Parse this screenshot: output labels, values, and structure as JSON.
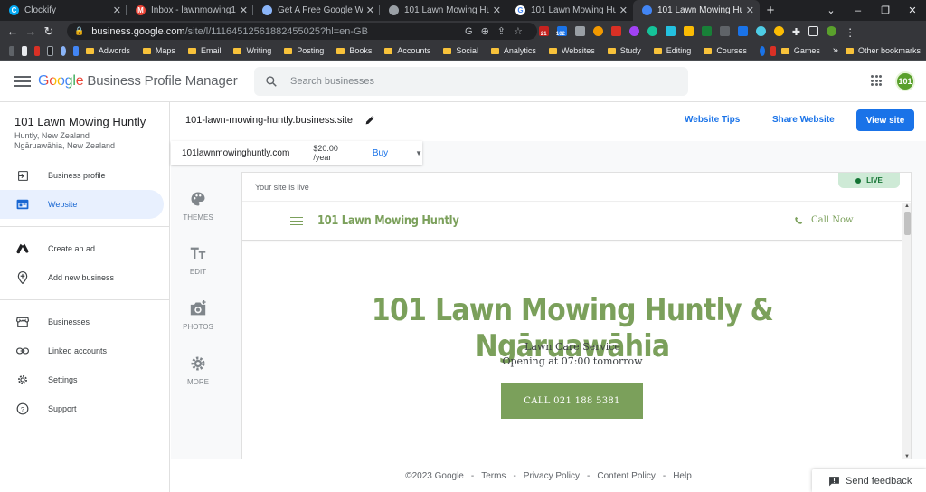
{
  "browser": {
    "tabs": [
      {
        "title": "Clockify",
        "active": false
      },
      {
        "title": "Inbox - lawnmowing101nz",
        "active": false
      },
      {
        "title": "Get A Free Google Website",
        "active": false
      },
      {
        "title": "101 Lawn Mowing Huntly -",
        "active": false
      },
      {
        "title": "101 Lawn Mowing Huntly -",
        "active": false
      },
      {
        "title": "101 Lawn Mowing Huntly",
        "active": true
      }
    ],
    "url_host": "business.google.com",
    "url_path": "/site/l/11164512561882455025?hl=en-GB",
    "bookmarks": [
      "Adwords",
      "Maps",
      "Email",
      "Writing",
      "Posting",
      "Books",
      "Accounts",
      "Social",
      "Analytics",
      "Websites",
      "Study",
      "Editing",
      "Courses",
      "Games"
    ],
    "overflow": "»",
    "other_bookmarks": "Other bookmarks",
    "badges": {
      "calendar": "21",
      "count": "102"
    }
  },
  "header": {
    "logo": "Google",
    "product": "Business Profile Manager",
    "search_placeholder": "Search businesses",
    "avatar_text": "101"
  },
  "sidebar": {
    "business_name": "101 Lawn Mowing Huntly",
    "address_line1": "Huntly, New Zealand",
    "address_line2": "Ngāruawāhia, New Zealand",
    "items": [
      {
        "label": "Business profile",
        "icon": "business-profile-icon"
      },
      {
        "label": "Website",
        "icon": "website-icon",
        "active": true
      },
      {
        "label": "Create an ad",
        "icon": "ads-icon"
      },
      {
        "label": "Add new business",
        "icon": "add-location-icon"
      },
      {
        "label": "Businesses",
        "icon": "storefront-icon"
      },
      {
        "label": "Linked accounts",
        "icon": "link-icon"
      },
      {
        "label": "Settings",
        "icon": "settings-icon"
      },
      {
        "label": "Support",
        "icon": "help-icon"
      }
    ]
  },
  "main": {
    "site_url": "101-lawn-mowing-huntly.business.site",
    "website_tips": "Website Tips",
    "share_website": "Share Website",
    "view_site": "View site",
    "domain": {
      "name": "101lawnmowinghuntly.com",
      "price": "$20.00 /year",
      "buy": "Buy"
    },
    "tools": [
      {
        "label": "THEMES",
        "icon": "palette-icon"
      },
      {
        "label": "EDIT",
        "icon": "text-edit-icon"
      },
      {
        "label": "PHOTOS",
        "icon": "camera-icon"
      },
      {
        "label": "MORE",
        "icon": "settings-icon"
      }
    ],
    "preview": {
      "status_text": "Your site is live",
      "live_badge": "LIVE",
      "site_name": "101 Lawn Mowing Huntly",
      "call_now": "Call Now",
      "hero_title": "101 Lawn Mowing Huntly & Ngāruawāhia",
      "category": "Lawn Care Service",
      "hours": "Opening at 07:00 tomorrow",
      "call_button": "CALL 021 188 5381"
    }
  },
  "footer": {
    "copyright": "©2023 Google",
    "sep": "-",
    "terms": "Terms",
    "privacy": "Privacy Policy",
    "content_policy": "Content Policy",
    "help": "Help",
    "feedback": "Send feedback"
  },
  "colors": {
    "accent": "#1a73e8",
    "site_green": "#7ba05b",
    "live_bg": "#ceead6",
    "nav_active_bg": "#e8f0fe"
  }
}
